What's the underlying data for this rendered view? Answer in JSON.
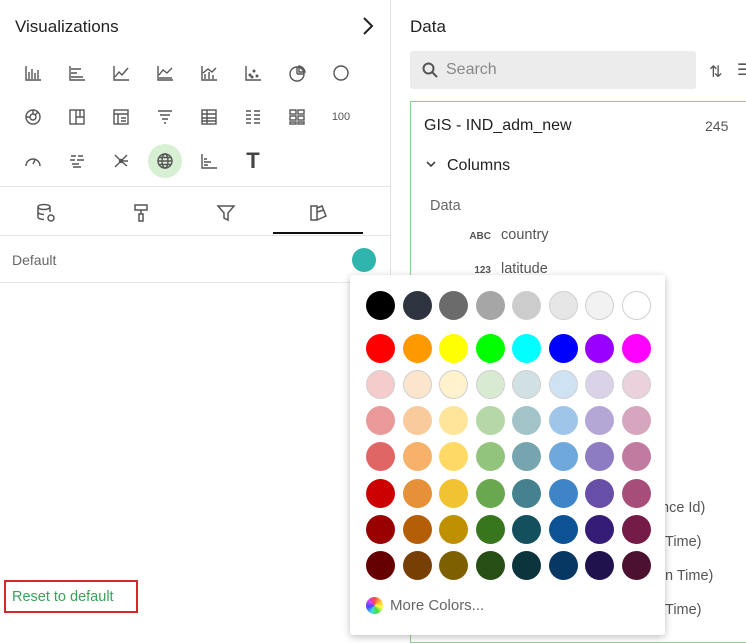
{
  "visualizations": {
    "title": "Visualizations",
    "icons": [
      [
        "bar-chart-icon",
        "horizontal-bar-icon",
        "line-chart-icon",
        "area-chart-icon",
        "combo-chart-icon",
        "scatter-icon",
        "pie-chart-icon",
        "donut-icon"
      ],
      [
        "sunburst-icon",
        "treemap-icon",
        "pivot-icon",
        "funnel-icon",
        "table-icon",
        "detail-table-icon",
        "card-grid-icon",
        "kpi-number-icon"
      ],
      [
        "gauge-icon",
        "wordcloud-icon",
        "network-icon",
        "map-icon",
        "range-icon",
        "text-icon"
      ]
    ],
    "kpi_text": "100",
    "text_icon_glyph": "T"
  },
  "default_label": "Default",
  "default_color": "#2fb5ad",
  "reset_label": "Reset to default",
  "data_panel": {
    "title": "Data",
    "search_placeholder": "Search",
    "dataset_name": "GIS - IND_adm_new",
    "dataset_count": "245",
    "columns_label": "Columns",
    "data_section": "Data",
    "fields": [
      {
        "type": "ABC",
        "name": "country"
      },
      {
        "type": "123",
        "name": "latitude"
      }
    ],
    "peek": [
      "nce Id)",
      "Time)",
      "n Time)",
      "Time)"
    ]
  },
  "color_picker": {
    "rows": [
      [
        "#000000",
        "#2e343f",
        "#6b6b6b",
        "#a6a6a6",
        "#cccccc",
        "#e6e6e6",
        "#f2f2f2",
        "#ffffff"
      ],
      [
        "#ff0000",
        "#ff9900",
        "#ffff00",
        "#00ff00",
        "#00ffff",
        "#0000ff",
        "#9900ff",
        "#ff00ff"
      ],
      [
        "#f4cccc",
        "#fce5cd",
        "#fff2cc",
        "#d9ead3",
        "#d0e0e3",
        "#cfe2f3",
        "#d9d2e9",
        "#ead1dc"
      ],
      [
        "#ea9999",
        "#f9cb9c",
        "#ffe599",
        "#b6d7a8",
        "#a2c4c9",
        "#9fc5e8",
        "#b4a7d6",
        "#d5a6bd"
      ],
      [
        "#e06666",
        "#f6b26b",
        "#ffd966",
        "#93c47d",
        "#76a5af",
        "#6fa8dc",
        "#8e7cc3",
        "#c27ba0"
      ],
      [
        "#cc0000",
        "#e69138",
        "#f1c232",
        "#6aa84f",
        "#45818e",
        "#3d85c6",
        "#674ea7",
        "#a64d79"
      ],
      [
        "#990000",
        "#b45f06",
        "#bf9000",
        "#38761d",
        "#134f5c",
        "#0b5394",
        "#351c75",
        "#741b47"
      ],
      [
        "#660000",
        "#783f04",
        "#7f6000",
        "#274e13",
        "#0c343d",
        "#073763",
        "#20124d",
        "#4c1130"
      ]
    ],
    "more_colors_label": "More Colors..."
  }
}
